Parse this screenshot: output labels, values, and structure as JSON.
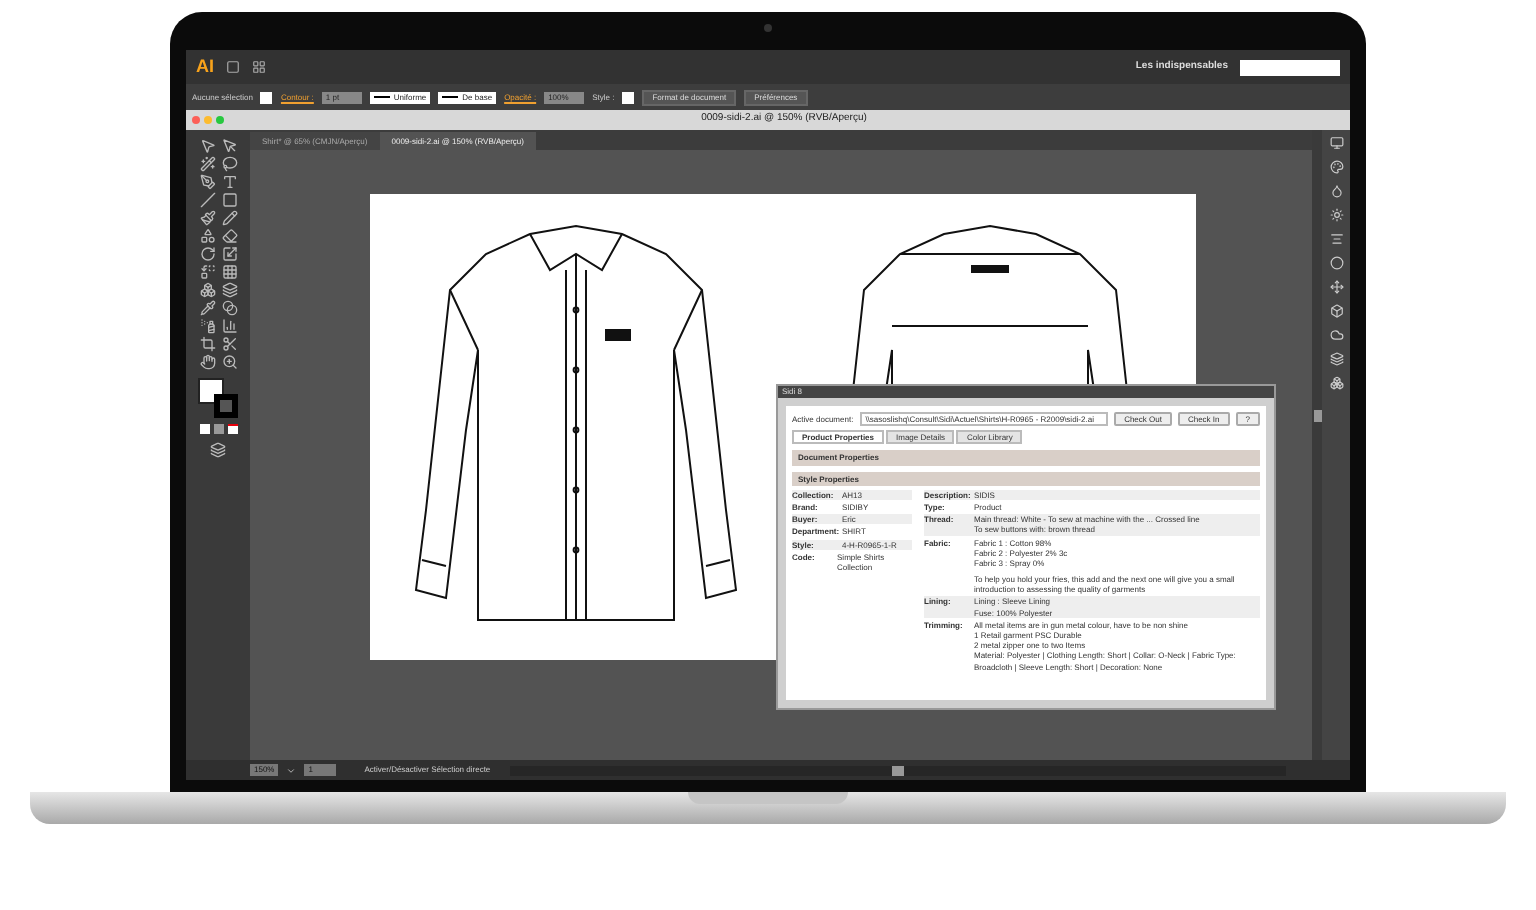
{
  "app_bar": {
    "logo": "AI",
    "workspace": "Les indispensables"
  },
  "control_bar": [
    {
      "kind": "label",
      "text": "Aucune sélection"
    },
    {
      "kind": "swatch"
    },
    {
      "kind": "label",
      "text": "Contour :",
      "accent": true
    },
    {
      "kind": "field",
      "text": "1 pt"
    },
    {
      "kind": "dropdown",
      "text": "Uniforme"
    },
    {
      "kind": "dropdown",
      "text": "De base"
    },
    {
      "kind": "label",
      "text": "Opacité :",
      "accent": true
    },
    {
      "kind": "field",
      "text": "100%"
    },
    {
      "kind": "label",
      "text": "Style :"
    },
    {
      "kind": "swatch"
    },
    {
      "kind": "button",
      "text": "Format de document"
    },
    {
      "kind": "button",
      "text": "Préférences"
    }
  ],
  "document": {
    "title": "0009-sidi-2.ai @ 150% (RVB/Aperçu)",
    "tabs": [
      {
        "label": "Shirt* @ 65% (CMJN/Aperçu)",
        "selected": false
      },
      {
        "label": "0009-sidi-2.ai @ 150% (RVB/Aperçu)",
        "selected": true
      }
    ]
  },
  "dialog": {
    "title": "Sidi 8",
    "active_document_label": "Active document:",
    "active_document": "\\\\sasoslishq\\Consult\\Sidi\\Actuel\\Shirts\\H-R0965 - R2009\\sidi-2.ai",
    "buttons": [
      "Check Out",
      "Check In",
      "?"
    ],
    "tabs": [
      {
        "label": "Product Properties",
        "selected": true
      },
      {
        "label": "Image Details",
        "selected": false
      },
      {
        "label": "Color Library",
        "selected": false
      }
    ],
    "sections": [
      "Document Properties",
      "Style Properties"
    ],
    "left_fields": [
      {
        "label": "Collection:",
        "value": "AH13"
      },
      {
        "label": "Brand:",
        "value": "SIDIBY"
      },
      {
        "label": "Buyer:",
        "value": "Eric"
      },
      {
        "label": "Department:",
        "value": "SHIRT"
      },
      {
        "label": "Style:",
        "value": "4-H-R0965-1-R"
      },
      {
        "label": "Code:",
        "value": "Simple Shirts Collection"
      }
    ],
    "right_fields": [
      {
        "label": "Description:",
        "lines": [
          "SIDIS"
        ]
      },
      {
        "label": "Type:",
        "lines": [
          "Product"
        ]
      },
      {
        "label": "Thread:",
        "lines": [
          "Main thread: White - To sew at machine with the ... Crossed line",
          "To sew buttons with: brown thread"
        ]
      },
      {
        "label": "Fabric:",
        "lines": [
          "Fabric 1 : Cotton 98%",
          "Fabric 2 : Polyester 2% 3c",
          "Fabric 3 : Spray 0%"
        ],
        "note": "To help you hold your fries, this add and the next one will give you a small introduction to assessing the quality of garments"
      },
      {
        "label": "Lining:",
        "lines": [
          "Lining : Sleeve Lining",
          "Fuse: 100% Polyester"
        ]
      },
      {
        "label": "Trimming:",
        "lines": [
          "All metal items are in gun metal colour, have to be non shine",
          "1 Retail garment PSC Durable",
          "2 metal zipper one to two Items",
          "Material: Polyester | Clothing Length: Short | Collar: O-Neck | Fabric Type: Broadcloth | Sleeve Length: Short | Decoration: None"
        ]
      }
    ]
  },
  "status_bar": {
    "zoom": "150%",
    "page": "1",
    "message": "Activer/Désactiver Sélection directe"
  }
}
